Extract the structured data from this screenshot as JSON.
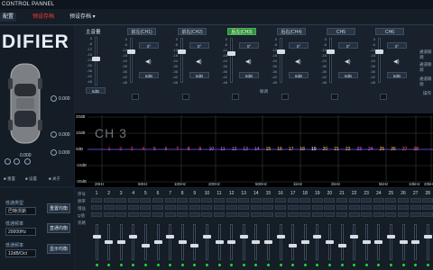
{
  "titlebar": {
    "title": "CONTROL PANNEL"
  },
  "menubar": {
    "items": [
      "配置",
      "预设存档",
      "预设存档 ▾"
    ]
  },
  "left": {
    "logo": "DIFIER",
    "volumes": [
      "0.000",
      "0.000",
      "0.000",
      "0.000",
      "0.000",
      "0.000"
    ],
    "legend": [
      "重置",
      "设置",
      "关于"
    ]
  },
  "mixer": {
    "master_label": "主音量",
    "master_value": "6dB",
    "channels": [
      "前左(CH1)",
      "前右(CH2)",
      "后左(CH3)",
      "后右(CH4)",
      "CH5",
      "CH6"
    ],
    "active_channel": 2,
    "delay_values": [
      "0°",
      "0°",
      "0°",
      "0°",
      "0°",
      "0°"
    ],
    "gain_values": [
      "6dB",
      "6dB",
      "6dB",
      "6dB",
      "6dB",
      "6dB"
    ],
    "sync_label": "联调",
    "scale": [
      "0",
      "-6",
      "-12",
      "-18",
      "-24",
      "-30",
      "-36",
      "-42",
      "-48"
    ],
    "right_labels": [
      "通道联调",
      "通道联调",
      "通道联调",
      "操作"
    ]
  },
  "graph": {
    "channel_label": "CH 3",
    "y_ticks": [
      "20dB",
      "10dB",
      "0dB",
      "-10dB",
      "-20dB"
    ],
    "x_ticks": [
      "20Hz",
      "50Hz",
      "100Hz",
      "200Hz",
      "500Hz",
      "1kHz",
      "2kHz",
      "5kHz",
      "10kHz",
      "20kHz"
    ],
    "points": [
      "1",
      "2",
      "3",
      "4",
      "5",
      "6",
      "7",
      "8",
      "9",
      "10",
      "11",
      "12",
      "13",
      "14",
      "15",
      "16",
      "17",
      "18",
      "19",
      "20",
      "21",
      "22",
      "23",
      "24",
      "25",
      "26",
      "27",
      "28"
    ],
    "point_colors": [
      "#ff4d4d",
      "#ff4d4d",
      "#ff4d4d",
      "#ff4d4d",
      "#ff6a6a",
      "#ff6a6a",
      "#ff6a6a",
      "#ff6a6a",
      "#ff6a6a",
      "#d77bff",
      "#d77bff",
      "#d77bff",
      "#d77bff",
      "#d77bff",
      "#ffd24d",
      "#ffd24d",
      "#ffd24d",
      "#ffd24d",
      "#ffffff",
      "#ffd24d",
      "#ffd24d",
      "#ffd24d",
      "#d77bff",
      "#d77bff",
      "#ffd24d",
      "#ffd24d",
      "#ff6a6a",
      "#ff6a6a"
    ]
  },
  "bottom_left": {
    "labels": [
      "低通类型",
      "低通频率",
      "低通频率"
    ],
    "fields": [
      "巴特沃斯",
      "20000Hz",
      "12dB/Oct"
    ],
    "buttons": [
      "重置均衡",
      "直通均衡",
      "显示均衡"
    ]
  },
  "bands": {
    "row_labels": [
      "序号",
      "频率",
      "增益",
      "Q值",
      "旁路"
    ],
    "numbers": [
      "1",
      "2",
      "3",
      "4",
      "5",
      "6",
      "7",
      "8",
      "9",
      "10",
      "11",
      "12",
      "13",
      "14",
      "15",
      "16",
      "17",
      "18",
      "19",
      "20",
      "21",
      "22",
      "23",
      "24",
      "25",
      "26",
      "27",
      "28"
    ]
  }
}
